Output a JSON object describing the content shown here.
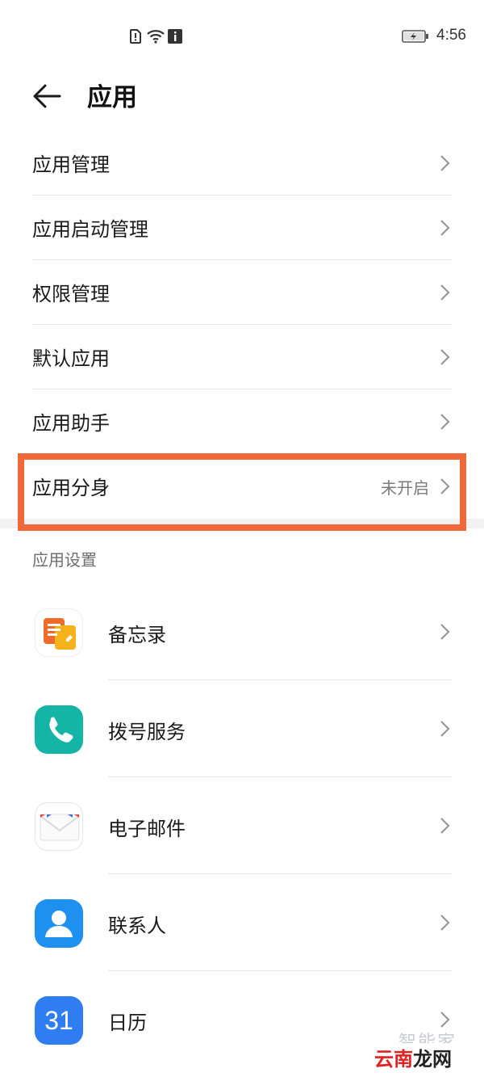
{
  "status_bar": {
    "time": "4:56",
    "icons": [
      "sim-alert-icon",
      "wifi-icon",
      "info-icon",
      "battery-charging-icon"
    ]
  },
  "header": {
    "title": "应用",
    "back_icon": "back-arrow-icon"
  },
  "menu": [
    {
      "label": "应用管理",
      "value": ""
    },
    {
      "label": "应用启动管理",
      "value": ""
    },
    {
      "label": "权限管理",
      "value": ""
    },
    {
      "label": "默认应用",
      "value": ""
    },
    {
      "label": "应用助手",
      "value": ""
    },
    {
      "label": "应用分身",
      "value": "未开启"
    }
  ],
  "highlight_color": "#f1683b",
  "app_settings": {
    "title": "应用设置",
    "items": [
      {
        "label": "备忘录",
        "icon": "notes-icon"
      },
      {
        "label": "拨号服务",
        "icon": "phone-icon"
      },
      {
        "label": "电子邮件",
        "icon": "email-icon"
      },
      {
        "label": "联系人",
        "icon": "contacts-icon"
      },
      {
        "label": "日历",
        "icon": "calendar-icon",
        "icon_text": "31"
      }
    ]
  },
  "watermark": {
    "top": "智能家",
    "badge_red": "云南",
    "badge_black": "龙网"
  }
}
